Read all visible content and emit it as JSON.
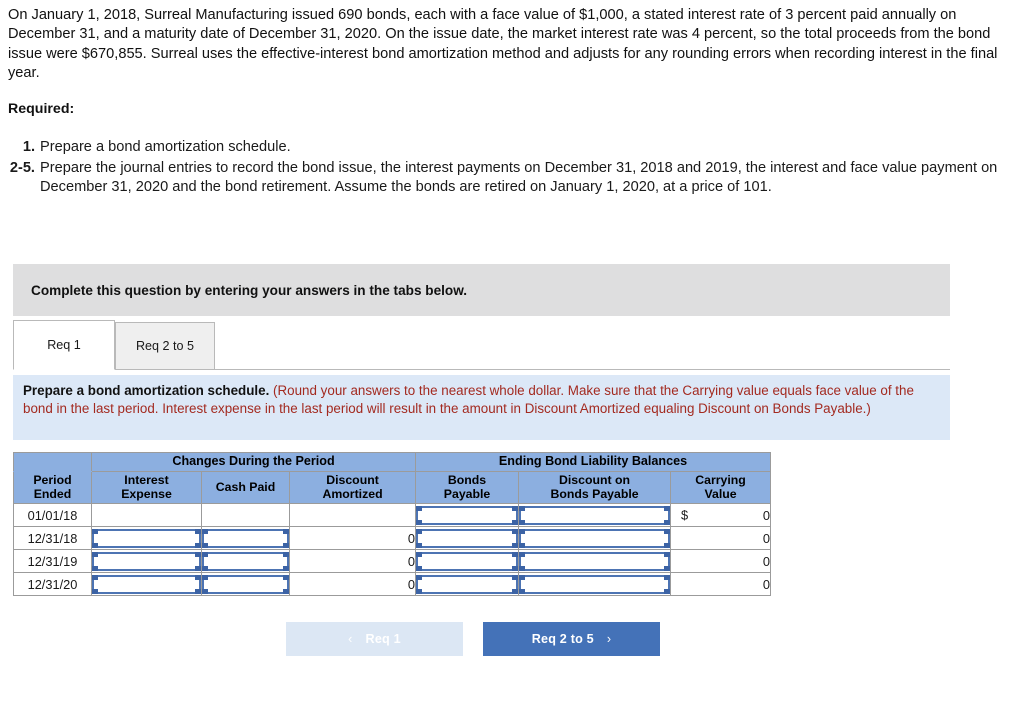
{
  "problem": {
    "paragraph": "On January 1, 2018, Surreal Manufacturing issued 690 bonds, each with a face value of $1,000, a stated interest rate of 3 percent paid annually on December 31, and a maturity date of December 31, 2020. On the issue date, the market interest rate was 4 percent, so the total proceeds from the bond issue were $670,855. Surreal uses the effective-interest bond amortization method and adjusts for any rounding errors when recording interest in the final year."
  },
  "required": {
    "label": "Required:",
    "items": [
      {
        "num": "1.",
        "text": "Prepare a bond amortization schedule."
      },
      {
        "num": "2-5.",
        "text": "Prepare the journal entries to record the bond issue, the interest payments on December 31, 2018 and 2019, the interest and face value payment on December 31, 2020 and the bond retirement. Assume the bonds are retired on January 1, 2020, at a price of 101."
      }
    ]
  },
  "banner": {
    "text": "Complete this question by entering your answers in the tabs below."
  },
  "tabs": [
    {
      "label": "Req 1",
      "active": true
    },
    {
      "label": "Req 2 to 5",
      "active": false
    }
  ],
  "instruction": {
    "bold": "Prepare a bond amortization schedule.",
    "red": "(Round your answers to the nearest whole dollar. Make sure that the Carrying value equals face value of the bond in the last period. Interest expense in the last period will result in the amount in Discount Amortized equaling Discount on Bonds Payable.)"
  },
  "table": {
    "group_headers": [
      {
        "label": "",
        "span": 1
      },
      {
        "label": "Changes During the Period",
        "span": 3
      },
      {
        "label": "Ending Bond Liability Balances",
        "span": 3
      }
    ],
    "columns": [
      {
        "line1": "Period",
        "line2": "Ended"
      },
      {
        "line1": "Interest",
        "line2": "Expense"
      },
      {
        "line1": "Cash Paid",
        "line2": ""
      },
      {
        "line1": "Discount",
        "line2": "Amortized"
      },
      {
        "line1": "Bonds",
        "line2": "Payable"
      },
      {
        "line1": "Discount on",
        "line2": "Bonds Payable"
      },
      {
        "line1": "Carrying",
        "line2": "Value"
      }
    ],
    "rows": [
      {
        "period": "01/01/18",
        "interest_expense": {
          "type": "empty",
          "value": ""
        },
        "cash_paid": {
          "type": "empty",
          "value": ""
        },
        "discount_amortized": {
          "type": "text",
          "value": ""
        },
        "bonds_payable": {
          "type": "input",
          "value": ""
        },
        "discount_on_bonds_payable": {
          "type": "input",
          "value": ""
        },
        "carrying_value": {
          "type": "money",
          "currency": "$",
          "value": "0"
        }
      },
      {
        "period": "12/31/18",
        "interest_expense": {
          "type": "input",
          "value": ""
        },
        "cash_paid": {
          "type": "input",
          "value": ""
        },
        "discount_amortized": {
          "type": "text",
          "value": "0"
        },
        "bonds_payable": {
          "type": "input",
          "value": ""
        },
        "discount_on_bonds_payable": {
          "type": "input",
          "value": ""
        },
        "carrying_value": {
          "type": "text",
          "value": "0"
        }
      },
      {
        "period": "12/31/19",
        "interest_expense": {
          "type": "input",
          "value": ""
        },
        "cash_paid": {
          "type": "input",
          "value": ""
        },
        "discount_amortized": {
          "type": "text",
          "value": "0"
        },
        "bonds_payable": {
          "type": "input",
          "value": ""
        },
        "discount_on_bonds_payable": {
          "type": "input",
          "value": ""
        },
        "carrying_value": {
          "type": "text",
          "value": "0"
        }
      },
      {
        "period": "12/31/20",
        "interest_expense": {
          "type": "input",
          "value": ""
        },
        "cash_paid": {
          "type": "input",
          "value": ""
        },
        "discount_amortized": {
          "type": "text",
          "value": "0"
        },
        "bonds_payable": {
          "type": "input",
          "value": ""
        },
        "discount_on_bonds_payable": {
          "type": "input",
          "value": ""
        },
        "carrying_value": {
          "type": "text",
          "value": "0"
        }
      }
    ]
  },
  "nav": {
    "prev": {
      "label": "Req 1",
      "chevron": "‹",
      "enabled": false
    },
    "next": {
      "label": "Req 2 to 5",
      "chevron": "›",
      "enabled": true
    }
  },
  "colors": {
    "header_blue": "#8cafe0",
    "input_border": "#4d74b3",
    "active_button": "#4472b8",
    "disabled_button": "#dce7f4",
    "banner_gray": "#dededf",
    "instruction_blue": "#dce8f7",
    "instruction_red": "#a32a20"
  }
}
